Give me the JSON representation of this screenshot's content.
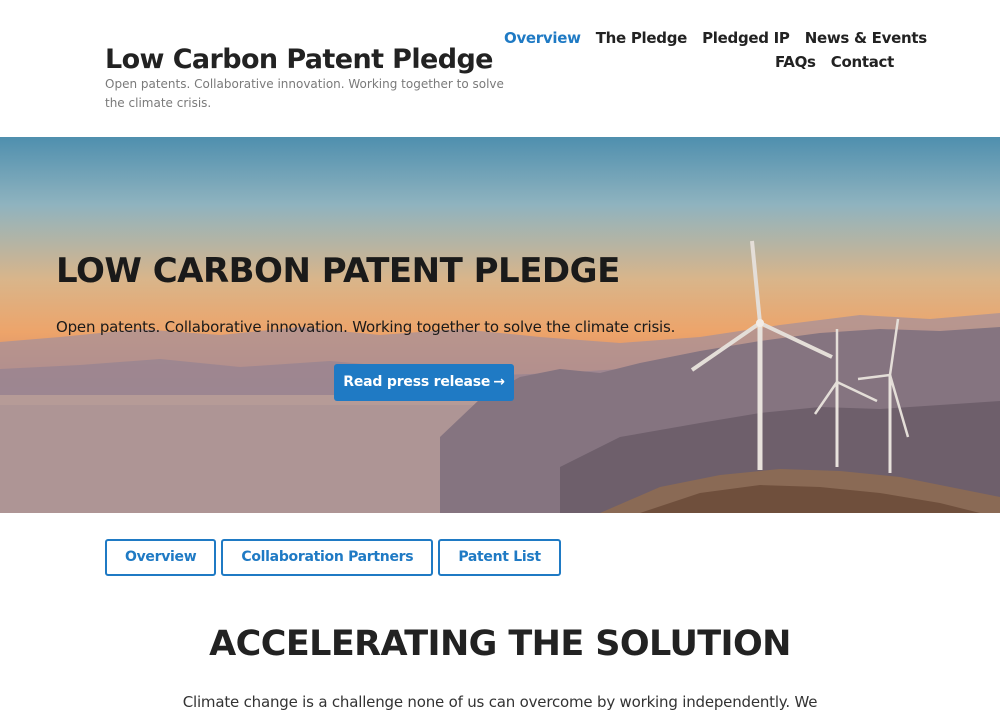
{
  "header": {
    "title": "Low Carbon Patent Pledge",
    "tagline": "Open patents. Collaborative innovation. Working together to solve the climate crisis."
  },
  "nav": {
    "items": [
      {
        "label": "Overview"
      },
      {
        "label": "The Pledge"
      },
      {
        "label": "Pledged IP"
      },
      {
        "label": "News & Events"
      },
      {
        "label": "FAQs"
      },
      {
        "label": "Contact"
      }
    ],
    "active": "Overview"
  },
  "hero": {
    "title": "LOW CARBON PATENT PLEDGE",
    "subtitle": "Open patents. Collaborative innovation. Working together to solve the climate crisis.",
    "button_label": "Read press release",
    "button_arrow": "→"
  },
  "tabs": [
    {
      "label": "Overview"
    },
    {
      "label": "Collaboration Partners"
    },
    {
      "label": "Patent List"
    }
  ],
  "section": {
    "title": "ACCELERATING THE SOLUTION",
    "text": "Climate change is a challenge none of us can overcome by working independently. We"
  },
  "colors": {
    "accent": "#1f7ac4",
    "text": "#222222",
    "tagline": "#7a7a7a"
  }
}
